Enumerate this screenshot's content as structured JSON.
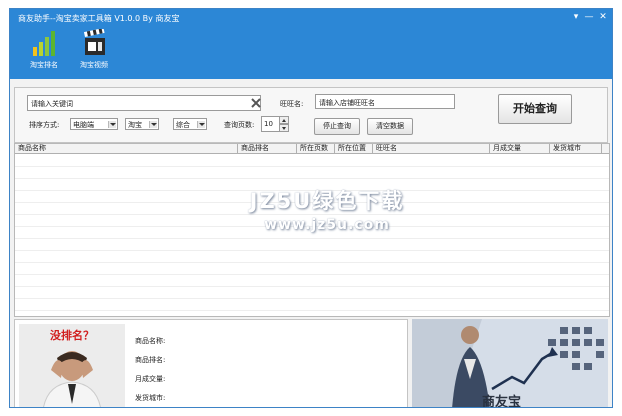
{
  "window": {
    "title": "商友助手--淘宝卖家工具箱 V1.0.0 By 商友宝",
    "controls": {
      "settings": "▾",
      "minimize": "—",
      "close": "✕"
    }
  },
  "toolbar": {
    "items": [
      {
        "label": "淘宝排名",
        "icon": "bar-chart-icon"
      },
      {
        "label": "淘宝视频",
        "icon": "film-clapper-icon"
      }
    ]
  },
  "search": {
    "keyword_placeholder": "请输入关键词",
    "shop_label": "旺旺名:",
    "shop_placeholder": "请输入店铺旺旺名",
    "sort_label": "排序方式:",
    "device_value": "电脑端",
    "platform_value": "淘宝",
    "order_value": "综合",
    "pages_label": "查询页数:",
    "pages_value": "10",
    "stop_label": "停止查询",
    "clear_label": "清空数据",
    "start_label": "开始查询"
  },
  "results": {
    "columns": [
      "商品名称",
      "商品排名",
      "所在页数",
      "所在位置",
      "旺旺名",
      "月成交量",
      "发货城市"
    ],
    "rows": []
  },
  "watermark": {
    "main": "JZ5U绿色下载",
    "sub": "www.jz5u.com"
  },
  "detail": {
    "image_caption": "没排名？",
    "fields": [
      "商品名称:",
      "商品排名:",
      "月成交量:",
      "发货城市:"
    ]
  },
  "banner": {
    "text": "商友宝"
  },
  "colors": {
    "titlebar": "#2c87d6",
    "window_border": "#3d83c6",
    "caption_red": "#d11e1e"
  }
}
